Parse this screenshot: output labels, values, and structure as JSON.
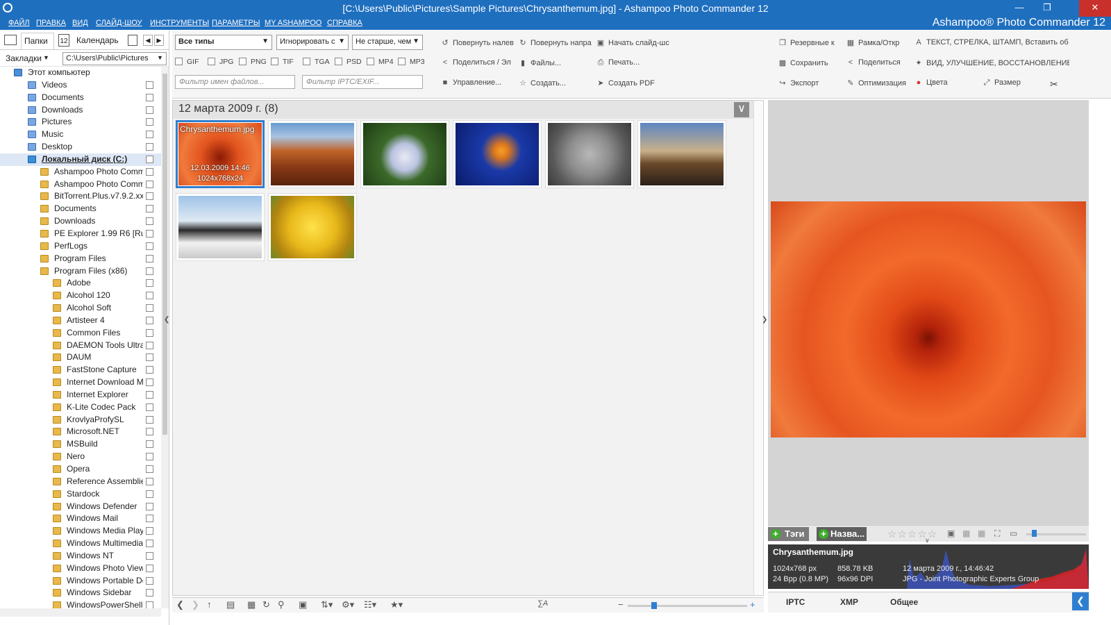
{
  "window": {
    "title": "[C:\\Users\\Public\\Pictures\\Sample Pictures\\Chrysanthemum.jpg] - Ashampoo Photo Commander 12",
    "brand": "Ashampoo® Photo Commander 12"
  },
  "menu": [
    "ФАЙЛ",
    "ПРАВКА",
    "ВИД",
    "СЛАЙД-ШОУ",
    "ИНСТРУМЕНТЫ",
    "ПАРАМЕТРЫ",
    "MY ASHAMPOO",
    "СПРАВКА"
  ],
  "left": {
    "tab_folders": "Папки",
    "tab_calendar": "Календарь",
    "calendar_day": "12",
    "bookmarks": "Закладки",
    "path": "C:\\Users\\Public\\Pictures",
    "tree": [
      {
        "label": "Этот компьютер",
        "level": 0,
        "kind": "pc"
      },
      {
        "label": "Videos",
        "level": 1,
        "kind": "lib"
      },
      {
        "label": "Documents",
        "level": 1,
        "kind": "lib"
      },
      {
        "label": "Downloads",
        "level": 1,
        "kind": "lib"
      },
      {
        "label": "Pictures",
        "level": 1,
        "kind": "lib"
      },
      {
        "label": "Music",
        "level": 1,
        "kind": "lib"
      },
      {
        "label": "Desktop",
        "level": 1,
        "kind": "lib"
      },
      {
        "label": "Локальный диск (C:)",
        "level": 1,
        "kind": "drive",
        "selected": true
      },
      {
        "label": "Ashampoo Photo Comm",
        "level": 2
      },
      {
        "label": "Ashampoo Photo Comm",
        "level": 2
      },
      {
        "label": "BitTorrent.Plus.v7.9.2.xxx",
        "level": 2
      },
      {
        "label": "Documents",
        "level": 2
      },
      {
        "label": "Downloads",
        "level": 2
      },
      {
        "label": "PE Explorer 1.99 R6 [Rus]",
        "level": 2
      },
      {
        "label": "PerfLogs",
        "level": 2
      },
      {
        "label": "Program Files",
        "level": 2
      },
      {
        "label": "Program Files (x86)",
        "level": 2
      },
      {
        "label": "Adobe",
        "level": 3
      },
      {
        "label": "Alcohol 120",
        "level": 3
      },
      {
        "label": "Alcohol Soft",
        "level": 3
      },
      {
        "label": "Artisteer 4",
        "level": 3
      },
      {
        "label": "Common Files",
        "level": 3
      },
      {
        "label": "DAEMON Tools Ultra",
        "level": 3
      },
      {
        "label": "DAUM",
        "level": 3
      },
      {
        "label": "FastStone Capture",
        "level": 3
      },
      {
        "label": "Internet Download M",
        "level": 3
      },
      {
        "label": "Internet Explorer",
        "level": 3
      },
      {
        "label": "K-Lite Codec Pack",
        "level": 3
      },
      {
        "label": "KrovlyaProfySL",
        "level": 3
      },
      {
        "label": "Microsoft.NET",
        "level": 3
      },
      {
        "label": "MSBuild",
        "level": 3
      },
      {
        "label": "Nero",
        "level": 3
      },
      {
        "label": "Opera",
        "level": 3
      },
      {
        "label": "Reference Assemblie",
        "level": 3
      },
      {
        "label": "Stardock",
        "level": 3
      },
      {
        "label": "Windows Defender",
        "level": 3
      },
      {
        "label": "Windows Mail",
        "level": 3
      },
      {
        "label": "Windows Media Play",
        "level": 3
      },
      {
        "label": "Windows Multimedia",
        "level": 3
      },
      {
        "label": "Windows NT",
        "level": 3
      },
      {
        "label": "Windows Photo View",
        "level": 3
      },
      {
        "label": "Windows Portable De",
        "level": 3
      },
      {
        "label": "Windows Sidebar",
        "level": 3
      },
      {
        "label": "WindowsPowerShell",
        "level": 3
      }
    ]
  },
  "toolbar": {
    "type_select": "Все типы",
    "ignore_select": "Игнорировать с",
    "age_select": "Не старше, чем",
    "checkboxes": [
      "GIF",
      "JPG",
      "PNG",
      "TIF",
      "TGA",
      "PSD",
      "MP4",
      "MP3"
    ],
    "filter_names": "Фильтр имен файлов...",
    "filter_iptc": "Фильтр IPTC/EXIF...",
    "rotate_left": "Повернуть налев",
    "rotate_right": "Повернуть напра",
    "start_slideshow": "Начать слайд-шс",
    "share_email": "Поделиться / Эл",
    "files": "Файлы...",
    "print": "Печать...",
    "manage": "Управление...",
    "create": "Создать...",
    "create_pdf": "Создать PDF",
    "backup": "Резервные к",
    "frame": "Рамка/Откр",
    "text_tools": "ТЕКСТ, СТРЕЛКА, ШТАМП, Вставить об",
    "save": "Сохранить",
    "share": "Поделиться",
    "view_improve": "ВИД, УЛУЧШЕНИЕ, ВОССТАНОВЛЕНИЕ",
    "export": "Экспорт",
    "optimize": "Оптимизация",
    "colors": "Цвета",
    "resize": "Размер"
  },
  "gallery": {
    "group_title": "12 марта 2009 г. (8)",
    "selected_name": "Chrysanthemum.jpg",
    "selected_date": "12.03.2009 14:46",
    "selected_size": "1024x768x24",
    "thumbs": [
      {
        "bg": "radial-gradient(circle at 50% 55%,#8a1a05,#e2541e 35%,#f07a3c 70%,#d8491a)"
      },
      {
        "bg": "linear-gradient(180deg,#6a9ad0 0%,#a9c3e0 22%,#c0632a 45%,#8a3a16 70%,#5a230d 100%)"
      },
      {
        "bg": "radial-gradient(circle at 50% 55%,#e8eaf3 0%,#b9c2e0 25%,#3c6a2a 45%,#1d3a12 100%)"
      },
      {
        "bg": "radial-gradient(circle at 55% 45%,#f5a02a 0%,#e07a1a 12%,#1a3aa8 35%,#0a1a6a 100%)"
      },
      {
        "bg": "radial-gradient(circle at 50% 50%,#b8b8b8 0%,#8c8c8c 40%,#5a5a5a 70%,#3a3a3a 100%)"
      },
      {
        "bg": "linear-gradient(180deg,#5d86c2 0%,#c9b08a 45%,#6a4a2a 65%,#2a1f18 100%)"
      },
      {
        "bg": "linear-gradient(180deg,#9fc3e8 0%,#dfe9f3 40%,#2a2a2a 55%,#f2f2f2 75%,#c9c9c9 100%)"
      },
      {
        "bg": "radial-gradient(circle at 50% 50%,#ffe24a 0%,#e8b81a 45%,#b08310 75%,#6a8a2a 100%)"
      }
    ]
  },
  "info": {
    "tags": "Тэги",
    "name_btn": "Назва...",
    "stars": "☆☆☆☆☆",
    "filename": "Chrysanthemum.jpg",
    "dims": "1024x768 px",
    "bpp": "24 Bpp (0.8 MP)",
    "filesize": "858.78 KB",
    "dpi": "96x96 DPI",
    "date": "12 марта 2009 г., 14:46:42",
    "format": "JPG - Joint Photographic Experts Group"
  },
  "bottom_tabs": [
    "IPTC",
    "XMP",
    "Общее"
  ]
}
